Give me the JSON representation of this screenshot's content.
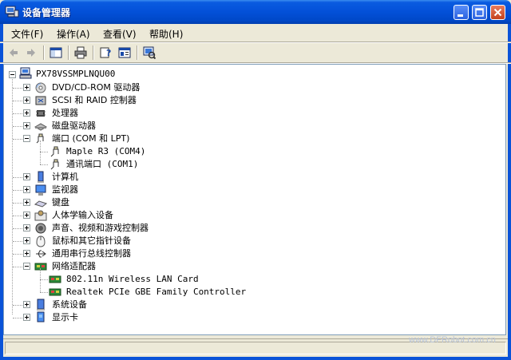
{
  "window": {
    "title": "设备管理器",
    "colors": {
      "titlebar": "#0350d8",
      "tree_bg": "#ffffff",
      "chrome": "#ece9d8"
    }
  },
  "menu": [
    {
      "label": "文件(F)"
    },
    {
      "label": "操作(A)"
    },
    {
      "label": "查看(V)"
    },
    {
      "label": "帮助(H)"
    }
  ],
  "toolbar": {
    "icons": [
      "back-arrow-icon",
      "forward-arrow-icon",
      "show-hide-tree-icon",
      "print-icon",
      "properties-help-icon",
      "console-view-icon",
      "scan-hardware-icon"
    ]
  },
  "tree": {
    "root": "PX78VSSMPLNQU00",
    "categories": [
      {
        "label": "DVD/CD-ROM 驱动器",
        "icon": "cdrom-icon",
        "expanded": false
      },
      {
        "label": "SCSI 和 RAID 控制器",
        "icon": "scsi-icon",
        "expanded": false
      },
      {
        "label": "处理器",
        "icon": "processor-icon",
        "expanded": false
      },
      {
        "label": "磁盘驱动器",
        "icon": "disk-drive-icon",
        "expanded": false
      },
      {
        "label": "端口 (COM 和 LPT)",
        "icon": "port-icon",
        "expanded": true,
        "children": [
          {
            "label": "Maple R3 (COM4)"
          },
          {
            "label": "通讯端口 (COM1)"
          }
        ]
      },
      {
        "label": "计算机",
        "icon": "computer-icon",
        "expanded": false
      },
      {
        "label": "监视器",
        "icon": "monitor-icon",
        "expanded": false
      },
      {
        "label": "键盘",
        "icon": "keyboard-icon",
        "expanded": false
      },
      {
        "label": "人体学输入设备",
        "icon": "hid-icon",
        "expanded": false
      },
      {
        "label": "声音、视频和游戏控制器",
        "icon": "sound-icon",
        "expanded": false
      },
      {
        "label": "鼠标和其它指针设备",
        "icon": "mouse-icon",
        "expanded": false
      },
      {
        "label": "通用串行总线控制器",
        "icon": "usb-icon",
        "expanded": false
      },
      {
        "label": "网络适配器",
        "icon": "network-adapter-icon",
        "expanded": true,
        "children": [
          {
            "label": "802.11n Wireless LAN Card"
          },
          {
            "label": "Realtek PCIe GBE Family Controller"
          }
        ]
      },
      {
        "label": "系统设备",
        "icon": "system-device-icon",
        "expanded": false
      },
      {
        "label": "显示卡",
        "icon": "display-adapter-icon",
        "expanded": false
      }
    ]
  },
  "watermark": "www.DFRobot.com.cn"
}
